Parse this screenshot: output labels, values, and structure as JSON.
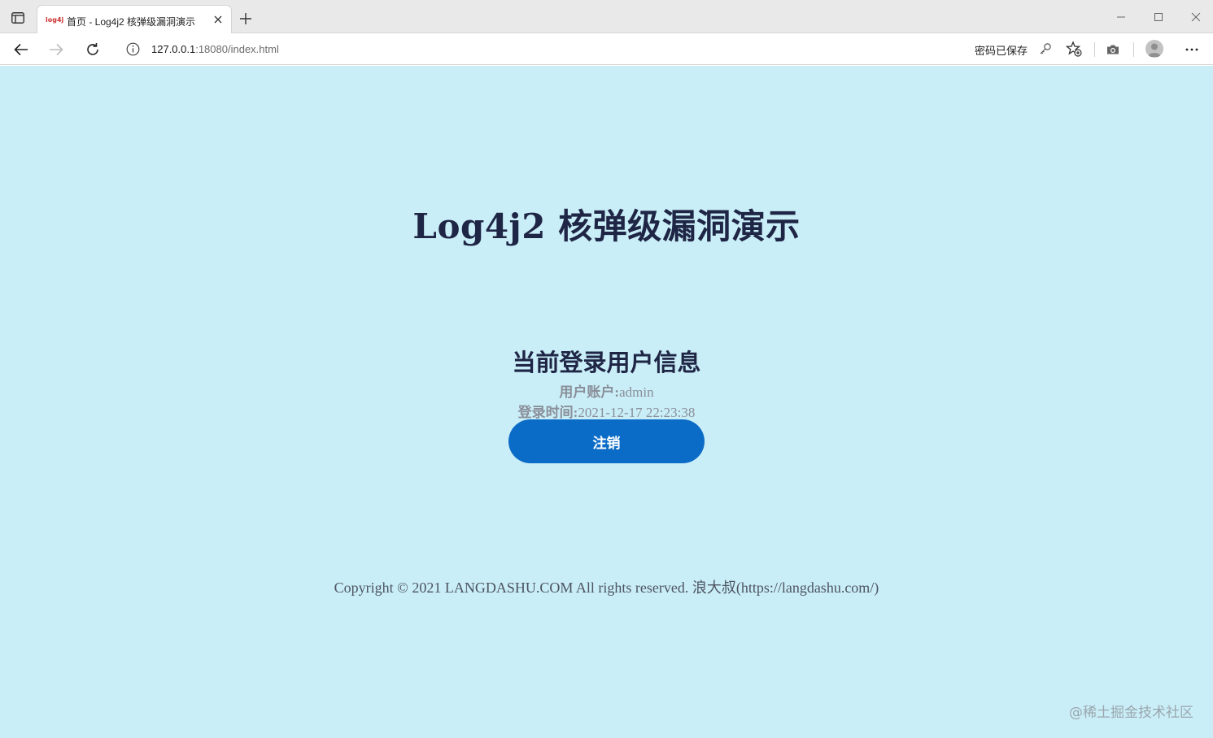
{
  "browser": {
    "tab": {
      "favicon_text": "log4j",
      "title": "首页 - Log4j2 核弹级漏洞演示"
    },
    "address_bar": {
      "url_host": "127.0.0.1",
      "url_rest": ":18080/index.html",
      "password_saved_label": "密码已保存"
    },
    "icons": {
      "tab_actions": "tab-actions-icon",
      "close_tab": "close-icon",
      "new_tab": "plus-icon",
      "minimize": "minimize-icon",
      "maximize": "maximize-icon",
      "close_window": "close-icon",
      "back": "back-arrow-icon",
      "forward": "forward-arrow-icon",
      "refresh": "refresh-icon",
      "site_info": "info-icon",
      "password_key": "key-icon",
      "add_favorite": "star-add-icon",
      "screenshot": "camera-icon",
      "profile": "profile-avatar",
      "menu": "more-icon"
    }
  },
  "page": {
    "background_color": "#c9eef7",
    "title": "Log4j2 核弹级漏洞演示",
    "user_section": {
      "heading": "当前登录用户信息",
      "account_label": "用户账户:",
      "account_value": "admin",
      "login_time_label": "登录时间:",
      "login_time_value": "2021-12-17 22:23:38"
    },
    "logout_button": {
      "label": "注销",
      "color": "#0b6cc7"
    },
    "footer": {
      "copyright": "Copyright © 2021 LANGDASHU.COM All rights reserved. 浪大叔(https://langdashu.com/)"
    },
    "watermark": "@稀土掘金技术社区"
  }
}
